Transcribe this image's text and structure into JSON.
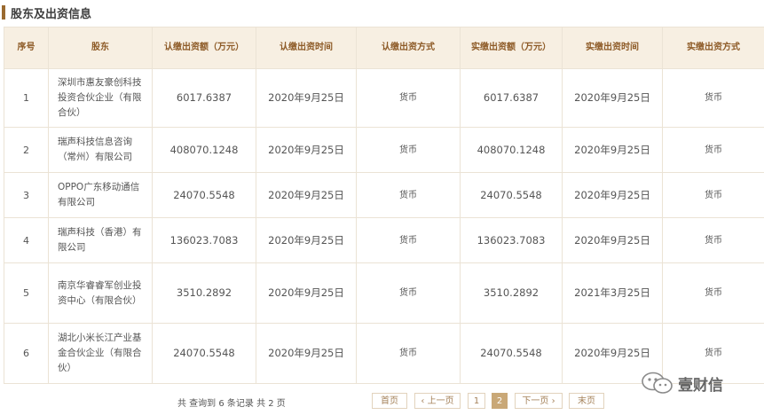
{
  "section": {
    "title": "股东及出资信息"
  },
  "table": {
    "headers": [
      "序号",
      "股东",
      "认缴出资额（万元）",
      "认缴出资时间",
      "认缴出资方式",
      "实缴出资额（万元）",
      "实缴出资时间",
      "实缴出资方式"
    ],
    "rows": [
      [
        "1",
        "深圳市惠友豪创科技投资合伙企业（有限合伙）",
        "6017.6387",
        "2020年9月25日",
        "货币",
        "6017.6387",
        "2020年9月25日",
        "货币"
      ],
      [
        "2",
        "瑞声科技信息咨询（常州）有限公司",
        "408070.1248",
        "2020年9月25日",
        "货币",
        "408070.1248",
        "2020年9月25日",
        "货币"
      ],
      [
        "3",
        "OPPO广东移动通信有限公司",
        "24070.5548",
        "2020年9月25日",
        "货币",
        "24070.5548",
        "2020年9月25日",
        "货币"
      ],
      [
        "4",
        "瑞声科技（香港）有限公司",
        "136023.7083",
        "2020年9月25日",
        "货币",
        "136023.7083",
        "2020年9月25日",
        "货币"
      ],
      [
        "5",
        "南京华睿睿军创业投资中心（有限合伙）",
        "3510.2892",
        "2020年9月25日",
        "货币",
        "3510.2892",
        "2021年3月25日",
        "货币"
      ],
      [
        "6",
        "湖北小米长江产业基金合伙企业（有限合伙）",
        "24070.5548",
        "2020年9月25日",
        "货币",
        "24070.5548",
        "2020年9月25日",
        "货币"
      ]
    ]
  },
  "pagination": {
    "info": "共 查询到 6 条记录 共 2 页",
    "first": "首页",
    "prev": "上一页",
    "page1": "1",
    "page2": "2",
    "next": "下一页",
    "last": "末页"
  },
  "watermark": {
    "text": "壹财信"
  }
}
